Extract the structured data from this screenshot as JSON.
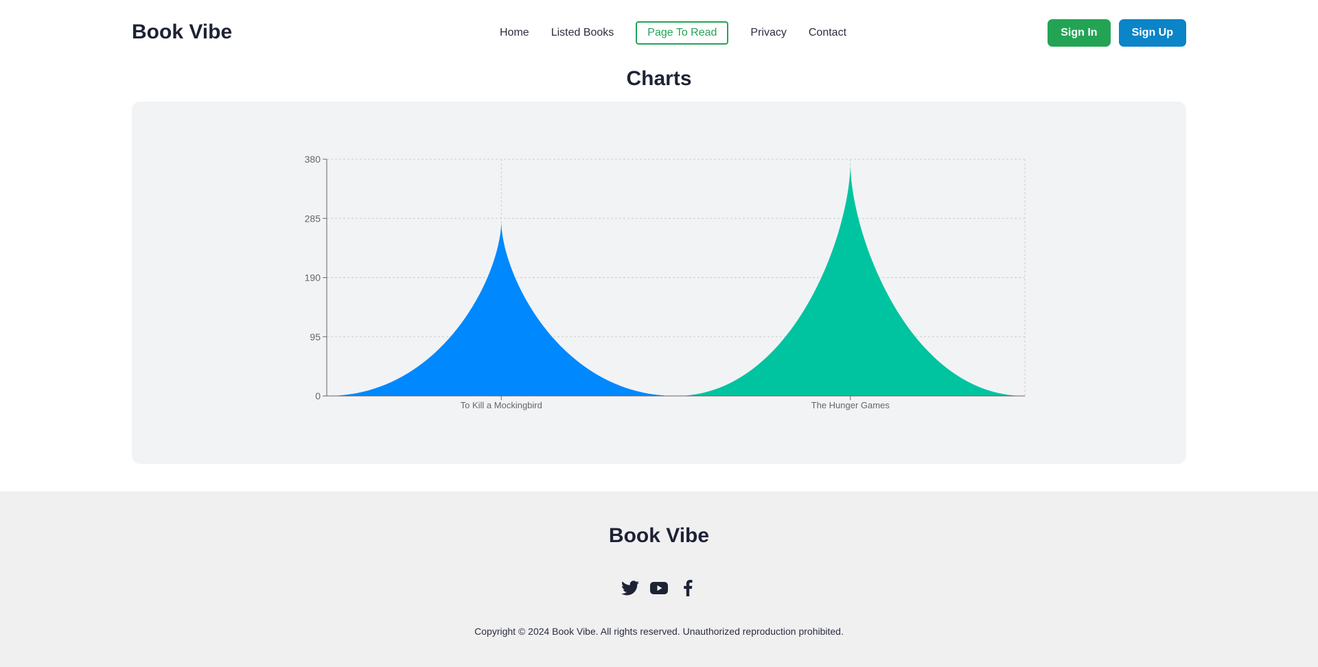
{
  "header": {
    "brand": "Book Vibe",
    "nav": [
      {
        "label": "Home"
      },
      {
        "label": "Listed Books"
      },
      {
        "label": "Page To Read",
        "active": true
      },
      {
        "label": "Privacy"
      },
      {
        "label": "Contact"
      }
    ],
    "sign_in": "Sign In",
    "sign_up": "Sign Up"
  },
  "main": {
    "title": "Charts"
  },
  "chart_data": {
    "type": "bar",
    "shape": "triangle",
    "categories": [
      "To Kill a Mockingbird",
      "The Hunger Games"
    ],
    "values": [
      281,
      374
    ],
    "colors": [
      "#0088fe",
      "#00c49f"
    ],
    "yticks": [
      0,
      95,
      190,
      285,
      380
    ],
    "ylim": [
      0,
      380
    ],
    "grid": true
  },
  "footer": {
    "brand": "Book Vibe",
    "socials": [
      "twitter-icon",
      "youtube-icon",
      "facebook-icon"
    ],
    "copyright": "Copyright © 2024 Book Vibe. All rights reserved. Unauthorized reproduction prohibited."
  }
}
